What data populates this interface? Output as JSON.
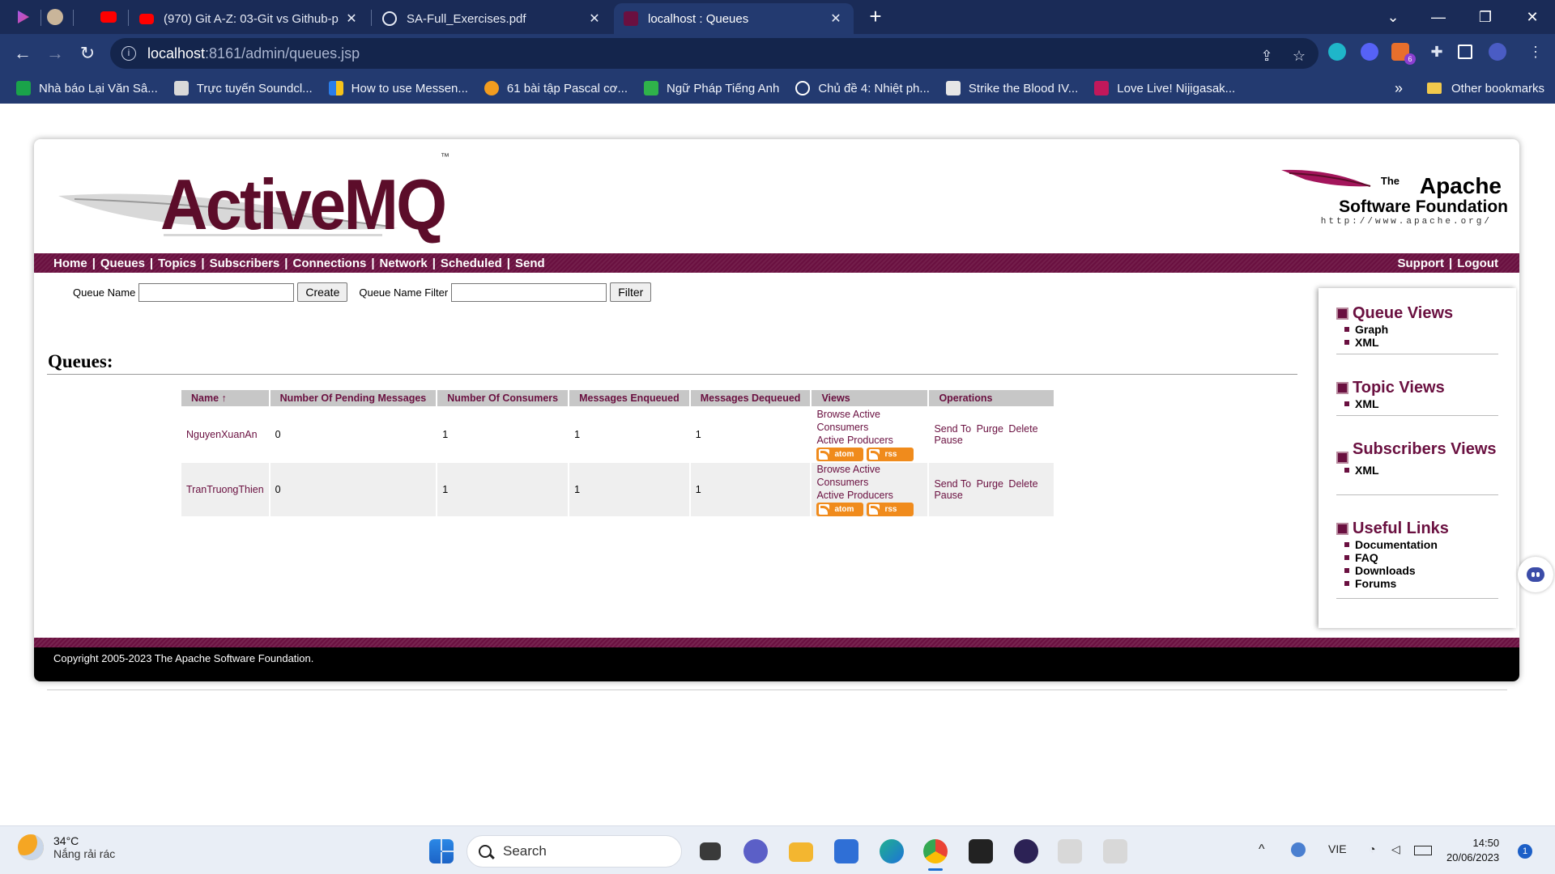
{
  "browser": {
    "tabs": [
      {
        "title": "(970) Git A-Z: 03-Git vs Github-p",
        "icon": "youtube-icon"
      },
      {
        "title": "SA-Full_Exercises.pdf",
        "icon": "globe-icon"
      },
      {
        "title": "localhost : Queues",
        "icon": "activemq-favicon"
      }
    ],
    "new_tab": "+",
    "address": {
      "host": "localhost",
      "path": ":8161/admin/queues.jsp"
    },
    "extension_badge": "6",
    "bookmarks": [
      "Nhà báo Lại Văn Sâ...",
      "Trực tuyến Soundcl...",
      "How to use Messen...",
      "61 bài tập Pascal cơ...",
      "Ngữ Pháp Tiếng Anh",
      "Chủ đề 4: Nhiệt ph...",
      "Strike the Blood IV...",
      "Love Live! Nijigasak..."
    ],
    "bookmarks_more": "»",
    "other_bookmarks": "Other bookmarks"
  },
  "header": {
    "logo": "ActiveMQ",
    "logo_tm": "™",
    "apache_the": "The",
    "apache_name": "Apache",
    "apache_sf": "Software Foundation",
    "apache_url": "http://www.apache.org/"
  },
  "menu": {
    "left": [
      "Home",
      "Queues",
      "Topics",
      "Subscribers",
      "Connections",
      "Network",
      "Scheduled",
      "Send"
    ],
    "right": [
      "Support",
      "Logout"
    ],
    "separator": "|"
  },
  "form": {
    "queue_name_label": "Queue Name",
    "create_button": "Create",
    "filter_label": "Queue Name Filter",
    "filter_button": "Filter"
  },
  "queues": {
    "heading": "Queues:",
    "columns": [
      "Name ↑",
      "Number Of Pending Messages",
      "Number Of Consumers",
      "Messages Enqueued",
      "Messages Dequeued",
      "Views",
      "Operations"
    ],
    "rows": [
      {
        "name": "NguyenXuanAn",
        "pending": "0",
        "consumers": "1",
        "enqueued": "1",
        "dequeued": "1"
      },
      {
        "name": "TranTruongThien",
        "pending": "0",
        "consumers": "1",
        "enqueued": "1",
        "dequeued": "1"
      }
    ],
    "views": {
      "browse": "Browse",
      "consumers": "Active Consumers",
      "producers": "Active Producers",
      "atom": "atom",
      "rss": "rss"
    },
    "operations": {
      "send": "Send To",
      "purge": "Purge",
      "delete": "Delete",
      "pause": "Pause"
    }
  },
  "sidebar": {
    "queue_views": {
      "title": "Queue Views",
      "items": [
        "Graph",
        "XML"
      ]
    },
    "topic_views": {
      "title": "Topic Views",
      "items": [
        "XML"
      ]
    },
    "subscribers_views": {
      "title": "Subscribers Views",
      "items": [
        "XML"
      ]
    },
    "useful_links": {
      "title": "Useful Links",
      "items": [
        "Documentation",
        "FAQ",
        "Downloads",
        "Forums"
      ]
    }
  },
  "footer": {
    "copyright": "Copyright 2005-2023 The Apache Software Foundation."
  },
  "taskbar": {
    "temperature": "34°C",
    "weather": "Nắng rải rác",
    "search_placeholder": "Search",
    "language": "VIE",
    "time": "14:50",
    "date": "20/06/2023",
    "notifications": "1"
  },
  "colors": {
    "brand": "#6a1040",
    "chrome_dark": "#1a2b57",
    "chrome": "#233a70"
  }
}
